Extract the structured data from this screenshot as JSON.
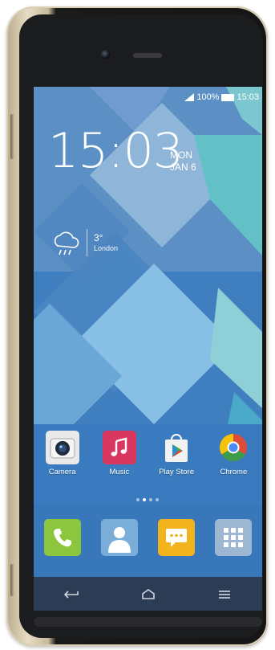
{
  "status_bar": {
    "battery_text": "100%",
    "time": "15:03"
  },
  "clock_widget": {
    "time": "15:03",
    "day": "MON",
    "date": "JAN 6"
  },
  "weather_widget": {
    "temperature": "3°",
    "city": "London",
    "icon": "rain-cloud-icon"
  },
  "home_apps": [
    {
      "label": "Camera",
      "icon": "camera-icon"
    },
    {
      "label": "Music",
      "icon": "music-icon"
    },
    {
      "label": "Play Store",
      "icon": "play-store-icon"
    },
    {
      "label": "Chrome",
      "icon": "chrome-icon"
    }
  ],
  "dock_apps": [
    {
      "icon": "phone-icon"
    },
    {
      "icon": "contacts-icon"
    },
    {
      "icon": "messages-icon"
    },
    {
      "icon": "app-drawer-icon"
    }
  ],
  "colors": {
    "wallpaper_base": "#3f7fc0",
    "device_trim": "#d9cdb2",
    "music_red": "#d8385f",
    "phone_green": "#8cc63f",
    "messages_yellow": "#f2b31d"
  }
}
